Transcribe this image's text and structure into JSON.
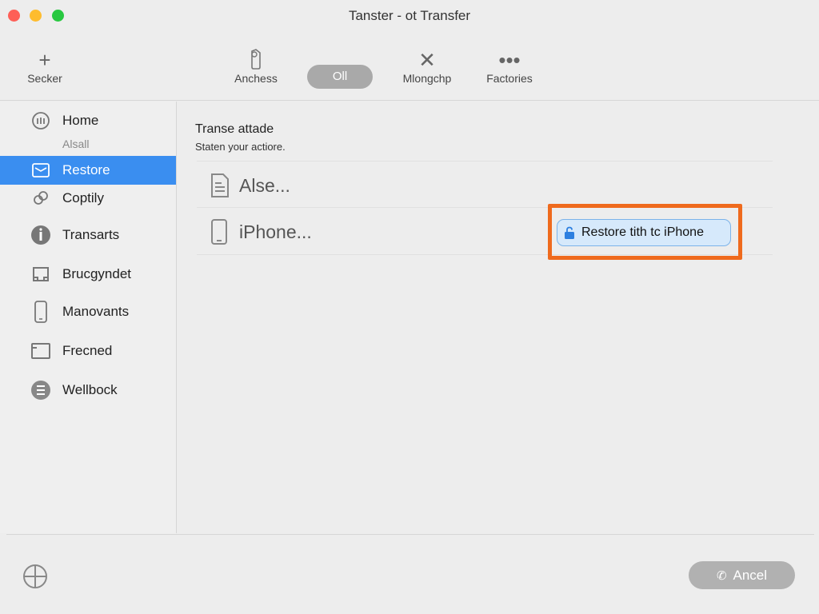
{
  "window": {
    "title": "Tanster - ot Transfer"
  },
  "toolbar": {
    "items": [
      {
        "label": "Secker",
        "icon": "plus-icon"
      },
      {
        "label": "Anchess",
        "icon": "settings-icon"
      },
      {
        "label": "Oll",
        "icon": "segmented-pill"
      },
      {
        "label": "Mlongchp",
        "icon": "close-icon"
      },
      {
        "label": "Factories",
        "icon": "more-icon"
      }
    ]
  },
  "sidebar": {
    "items": [
      {
        "label": "Home",
        "icon": "home-icon"
      },
      {
        "label": "Restore",
        "icon": "restore-icon"
      },
      {
        "label": "Coptily",
        "icon": "link-icon"
      },
      {
        "label": "Transarts",
        "icon": "info-icon"
      },
      {
        "label": "Brucgyndet",
        "icon": "folder-icon"
      },
      {
        "label": "Manovants",
        "icon": "phone-icon"
      },
      {
        "label": "Frecned",
        "icon": "window-icon"
      },
      {
        "label": "Wellbock",
        "icon": "menu-icon"
      }
    ],
    "home_sub": "Alsall"
  },
  "main": {
    "title": "Transe attade",
    "subtitle": "Staten your actiore.",
    "rows": [
      {
        "label": "Alse...",
        "icon": "document-icon"
      },
      {
        "label": "iPhone...",
        "icon": "iphone-icon"
      }
    ],
    "restore_button": "Restore tith tc iPhone"
  },
  "footer": {
    "cancel_label": "Ancel"
  },
  "colors": {
    "accent": "#3a8ef0",
    "highlight": "#ef6a1d",
    "button_fill": "#d6e9fb"
  }
}
